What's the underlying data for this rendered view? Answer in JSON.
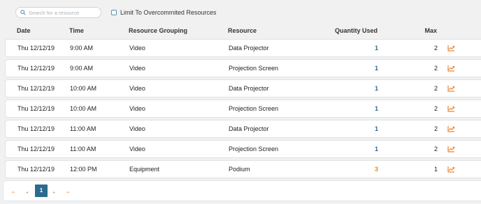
{
  "search": {
    "placeholder": "Search for a resource",
    "value": ""
  },
  "filter": {
    "label": "Limit To Overcommited Resources",
    "checked": false
  },
  "columns": {
    "date": "Date",
    "time": "Time",
    "grouping": "Resource Grouping",
    "resource": "Resource",
    "quantity": "Quantity Used",
    "max": "Max"
  },
  "rows": [
    {
      "date": "Thu 12/12/19",
      "time": "9:00 AM",
      "grouping": "Video",
      "resource": "Data Projector",
      "quantity": "1",
      "max": "2"
    },
    {
      "date": "Thu 12/12/19",
      "time": "9:00 AM",
      "grouping": "Video",
      "resource": "Projection Screen",
      "quantity": "1",
      "max": "2"
    },
    {
      "date": "Thu 12/12/19",
      "time": "10:00 AM",
      "grouping": "Video",
      "resource": "Data Projector",
      "quantity": "1",
      "max": "2"
    },
    {
      "date": "Thu 12/12/19",
      "time": "10:00 AM",
      "grouping": "Video",
      "resource": "Projection Screen",
      "quantity": "1",
      "max": "2"
    },
    {
      "date": "Thu 12/12/19",
      "time": "11:00 AM",
      "grouping": "Video",
      "resource": "Data Projector",
      "quantity": "1",
      "max": "2"
    },
    {
      "date": "Thu 12/12/19",
      "time": "11:00 AM",
      "grouping": "Video",
      "resource": "Projection Screen",
      "quantity": "1",
      "max": "2"
    },
    {
      "date": "Thu 12/12/19",
      "time": "12:00 PM",
      "grouping": "Equipment",
      "resource": "Podium",
      "quantity": "3",
      "max": "1"
    }
  ],
  "row_icon": "chart-trend-icon",
  "pagination": {
    "first": "⇤",
    "prev": "◂",
    "current": "1",
    "next": "▸",
    "last": "⇥"
  },
  "colors": {
    "accent": "#2c6b8e",
    "warning": "#e08a2c",
    "icon": "#e8873a"
  }
}
